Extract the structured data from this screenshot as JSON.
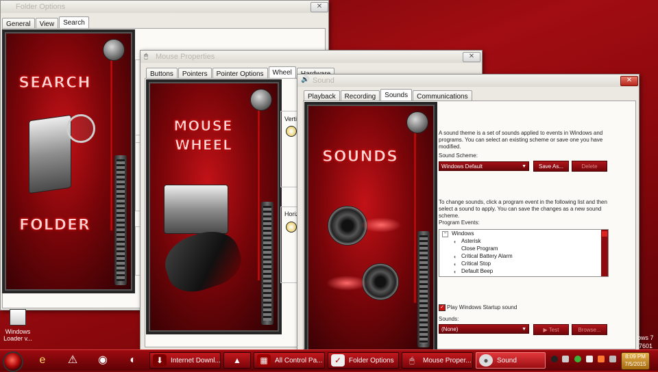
{
  "folder_options": {
    "title": "Folder Options",
    "tabs": [
      "General",
      "View",
      "Search"
    ],
    "active_tab": "Search",
    "art_top": "SEARCH",
    "art_bottom": "FOLDER",
    "close_glyph": "✕"
  },
  "mouse_properties": {
    "title": "Mouse Properties",
    "tabs": [
      "Buttons",
      "Pointers",
      "Pointer Options",
      "Wheel",
      "Hardware"
    ],
    "active_tab": "Wheel",
    "art_line1": "MOUSE",
    "art_line2": "WHEEL",
    "label_vertical": "Vertic",
    "label_horizontal": "Horizo",
    "close_glyph": "✕"
  },
  "sound": {
    "title": "Sound",
    "close_glyph": "✕",
    "tabs": [
      "Playback",
      "Recording",
      "Sounds",
      "Communications"
    ],
    "active_tab": "Sounds",
    "art_title": "SOUNDS",
    "description": "A sound theme is a set of sounds applied to events in Windows and programs.  You can select an existing scheme or save one you have modified.",
    "scheme_label": "Sound Scheme:",
    "scheme_value": "Windows Default",
    "save_as": "Save As...",
    "delete": "Delete",
    "instructions": "To change sounds, click a program event in the following list and then select a sound to apply.  You can save the changes as a new sound scheme.",
    "events_label": "Program Events:",
    "events_group": "Windows",
    "events": [
      "Asterisk",
      "Close Program",
      "Critical Battery Alarm",
      "Critical Stop",
      "Default Beep"
    ],
    "play_startup": "Play Windows Startup sound",
    "play_startup_checked": true,
    "sounds_label": "Sounds:",
    "sounds_value": "(None)",
    "test": "Test",
    "browse": "Browse..."
  },
  "desktop": {
    "icon_label": "Windows Loader v...",
    "edge_text_1": "ows 7",
    "edge_text_2": "7601"
  },
  "taskbar": {
    "buttons": [
      {
        "label": "Internet Downl...",
        "icon": "download-icon",
        "active": false
      },
      {
        "label": "",
        "icon": "triangle-icon",
        "active": false
      },
      {
        "label": "All Control Pa...",
        "icon": "control-panel-icon",
        "active": false
      },
      {
        "label": "Folder Options",
        "icon": "folder-options-icon",
        "active": false
      },
      {
        "label": "Mouse Proper...",
        "icon": "mouse-icon",
        "active": false
      },
      {
        "label": "Sound",
        "icon": "speaker-icon",
        "active": true
      }
    ],
    "clock_time": "8:09 PM",
    "clock_date": "7/5/2015"
  }
}
